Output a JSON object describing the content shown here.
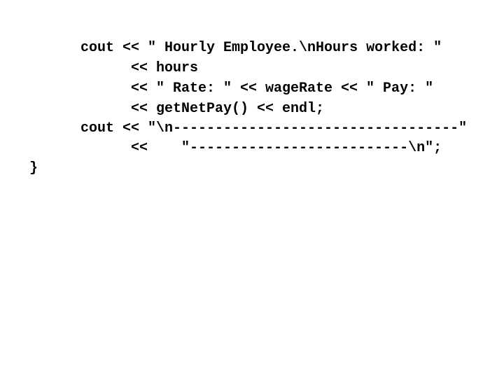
{
  "code": {
    "lines": [
      "cout << \" Hourly Employee.\\nHours worked: \"",
      "<< hours",
      "<< \" Rate: \" << wageRate << \" Pay: \"",
      "<< getNetPay() << endl;",
      "cout << \"\\n----------------------------------\"",
      "<<    \"--------------------------\\n\";",
      "}"
    ]
  }
}
